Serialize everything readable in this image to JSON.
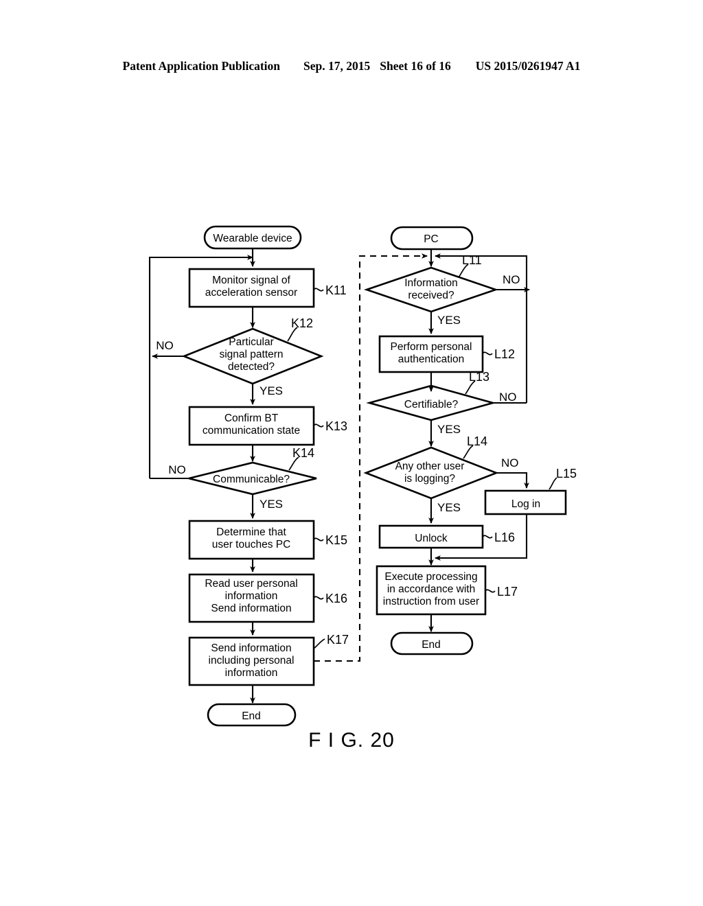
{
  "header": {
    "publication": "Patent Application Publication",
    "date": "Sep. 17, 2015",
    "sheet": "Sheet 16 of 16",
    "patent_number": "US 2015/0261947 A1"
  },
  "figure": {
    "caption": "F I G. 20"
  },
  "left_column": {
    "start_label": "Wearable device",
    "end_label": "End",
    "nodes": [
      {
        "id": "K11",
        "type": "process",
        "lines": [
          "Monitor signal of",
          "acceleration sensor"
        ],
        "ref": "K11"
      },
      {
        "id": "K12",
        "type": "decision",
        "lines": [
          "Particular",
          "signal pattern",
          "detected?"
        ],
        "ref": "K12",
        "yes": "YES",
        "no": "NO"
      },
      {
        "id": "K13",
        "type": "process",
        "lines": [
          "Confirm BT",
          "communication state"
        ],
        "ref": "K13"
      },
      {
        "id": "K14",
        "type": "decision",
        "lines": [
          "Communicable?"
        ],
        "ref": "K14",
        "yes": "YES",
        "no": "NO"
      },
      {
        "id": "K15",
        "type": "process",
        "lines": [
          "Determine that",
          "user touches PC"
        ],
        "ref": "K15"
      },
      {
        "id": "K16",
        "type": "process",
        "lines": [
          "Read user personal",
          "information",
          "Send information"
        ],
        "ref": "K16"
      },
      {
        "id": "K17",
        "type": "process",
        "lines": [
          "Send information",
          "including personal",
          "information"
        ],
        "ref": "K17"
      }
    ]
  },
  "right_column": {
    "start_label": "PC",
    "end_label": "End",
    "nodes": [
      {
        "id": "L11",
        "type": "decision",
        "lines": [
          "Information",
          "received?"
        ],
        "ref": "L11",
        "yes": "YES",
        "no": "NO"
      },
      {
        "id": "L12",
        "type": "process",
        "lines": [
          "Perform personal",
          "authentication"
        ],
        "ref": "L12"
      },
      {
        "id": "L13",
        "type": "decision",
        "lines": [
          "Certifiable?"
        ],
        "ref": "L13",
        "yes": "YES",
        "no": "NO"
      },
      {
        "id": "L14",
        "type": "decision",
        "lines": [
          "Any other user",
          "is logging?"
        ],
        "ref": "L14",
        "yes": "YES",
        "no": "NO"
      },
      {
        "id": "L15",
        "type": "process",
        "lines": [
          "Log in"
        ],
        "ref": "L15"
      },
      {
        "id": "L16",
        "type": "process",
        "lines": [
          "Unlock"
        ],
        "ref": "L16"
      },
      {
        "id": "L17",
        "type": "process",
        "lines": [
          "Execute processing",
          "in accordance with",
          "instruction from user"
        ],
        "ref": "L17"
      }
    ]
  },
  "text": {
    "wearable_device": "Wearable device",
    "pc": "PC",
    "end_left": "End",
    "end_right": "End",
    "k11_l1": "Monitor signal of",
    "k11_l2": "acceleration sensor",
    "k11_ref": "K11",
    "k12_l1": "Particular",
    "k12_l2": "signal pattern",
    "k12_l3": "detected?",
    "k12_ref": "K12",
    "k12_no": "NO",
    "k12_yes": "YES",
    "k13_l1": "Confirm BT",
    "k13_l2": "communication state",
    "k13_ref": "K13",
    "k14_l1": "Communicable?",
    "k14_ref": "K14",
    "k14_no": "NO",
    "k14_yes": "YES",
    "k15_l1": "Determine that",
    "k15_l2": "user touches PC",
    "k15_ref": "K15",
    "k16_l1": "Read user personal",
    "k16_l2": "information",
    "k16_l3": "Send information",
    "k16_ref": "K16",
    "k17_l1": "Send information",
    "k17_l2": "including personal",
    "k17_l3": "information",
    "k17_ref": "K17",
    "l11_l1": "Information",
    "l11_l2": "received?",
    "l11_ref": "L11",
    "l11_no": "NO",
    "l11_yes": "YES",
    "l12_l1": "Perform personal",
    "l12_l2": "authentication",
    "l12_ref": "L12",
    "l13_l1": "Certifiable?",
    "l13_ref": "L13",
    "l13_no": "NO",
    "l13_yes": "YES",
    "l14_l1": "Any other user",
    "l14_l2": "is logging?",
    "l14_ref": "L14",
    "l14_no": "NO",
    "l14_yes": "YES",
    "l15_l1": "Log in",
    "l15_ref": "L15",
    "l16_l1": "Unlock",
    "l16_ref": "L16",
    "l17_l1": "Execute processing",
    "l17_l2": "in accordance with",
    "l17_l3": "instruction from user",
    "l17_ref": "L17"
  },
  "colors": {
    "ink": "#000000",
    "paper": "#ffffff"
  }
}
